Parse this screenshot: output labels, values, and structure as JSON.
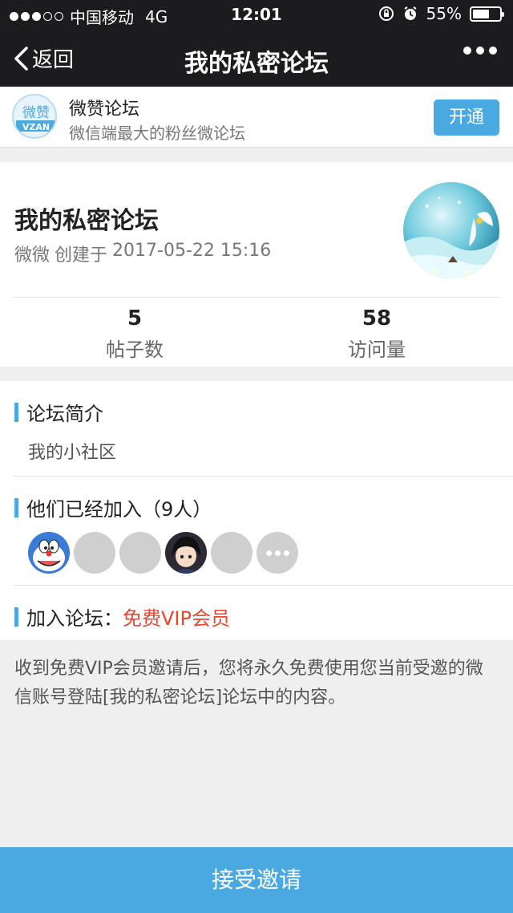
{
  "status_bar": {
    "carrier": "中国移动",
    "network": "4G",
    "time": "12:01",
    "battery": "55%",
    "signal_bars_filled": 3,
    "signal_bars_total": 5
  },
  "nav": {
    "back_label": "返回",
    "title": "我的私密论坛"
  },
  "banner": {
    "logo_top": "微赞",
    "logo_bottom": "VZAN",
    "title": "微赞论坛",
    "subtitle": "微信端最大的粉丝微论坛",
    "open_label": "开通"
  },
  "forum": {
    "name": "我的私密论坛",
    "creator": "微微",
    "created_prefix": "创建于",
    "created_at": "2017-05-22 15:16",
    "stats": [
      {
        "value": "5",
        "label": "帖子数"
      },
      {
        "value": "58",
        "label": "访问量"
      }
    ]
  },
  "intro": {
    "heading": "论坛简介",
    "text": "我的小社区"
  },
  "members": {
    "heading": "他们已经加入（9人）",
    "avatars": [
      "doraemon-avatar",
      "blank-avatar",
      "blank-avatar",
      "anime-avatar",
      "blank-avatar"
    ]
  },
  "join": {
    "label": "加入论坛：",
    "value": "免费VIP会员"
  },
  "notice": "收到免费VIP会员邀请后，您将永久免费使用您当前受邀的微信账号登陆[我的私密论坛]论坛中的内容。",
  "accept_label": "接受邀请",
  "colors": {
    "accent": "#4aa9e0",
    "highlight": "#e8462e",
    "nav_bg": "#1c1c1e"
  }
}
